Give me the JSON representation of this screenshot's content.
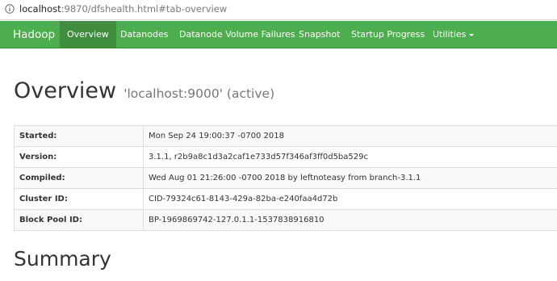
{
  "browser": {
    "url_host": "localhost",
    "url_rest": ":9870/dfshealth.html#tab-overview"
  },
  "navbar": {
    "brand": "Hadoop",
    "items": [
      {
        "label": "Overview",
        "active": true
      },
      {
        "label": "Datanodes"
      },
      {
        "label": "Datanode Volume Failures"
      },
      {
        "label": "Snapshot"
      },
      {
        "label": "Startup Progress"
      },
      {
        "label": "Utilities",
        "dropdown": true
      }
    ]
  },
  "overview": {
    "title": "Overview",
    "subtitle": "'localhost:9000' (active)",
    "rows": [
      {
        "label": "Started:",
        "value": "Mon Sep 24 19:00:37 -0700 2018"
      },
      {
        "label": "Version:",
        "value": "3.1.1, r2b9a8c1d3a2caf1e733d57f346af3ff0d5ba529c"
      },
      {
        "label": "Compiled:",
        "value": "Wed Aug 01 21:26:00 -0700 2018 by leftnoteasy from branch-3.1.1"
      },
      {
        "label": "Cluster ID:",
        "value": "CID-79324c61-8143-429a-82ba-e240faa4d72b"
      },
      {
        "label": "Block Pool ID:",
        "value": "BP-1969869742-127.0.1.1-1537838916810"
      }
    ]
  },
  "summary": {
    "title": "Summary"
  },
  "colors": {
    "navbar": "#4cae4c",
    "navbar_active": "#3e8e3e"
  }
}
